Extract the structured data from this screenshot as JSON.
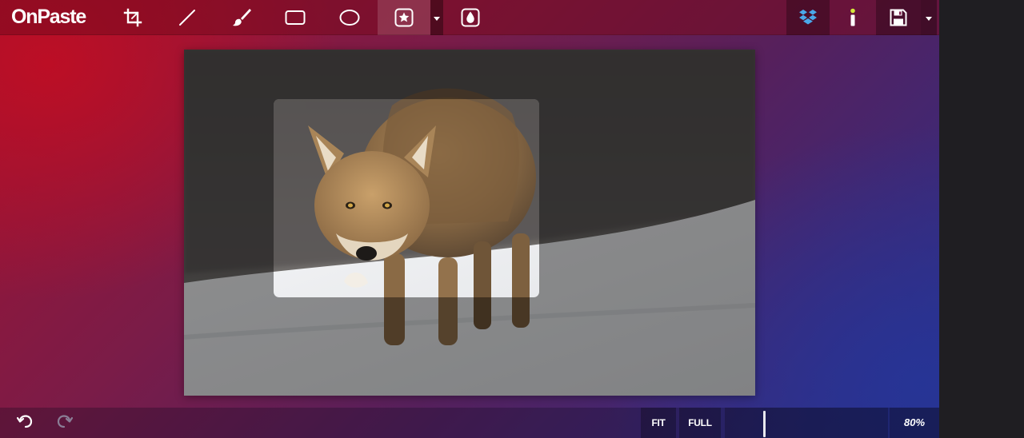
{
  "app": {
    "logo_text": "OnPaste"
  },
  "toolbar": {
    "tools": [
      {
        "id": "crop",
        "icon": "crop-icon"
      },
      {
        "id": "line",
        "icon": "line-icon"
      },
      {
        "id": "brush",
        "icon": "brush-icon"
      },
      {
        "id": "rectangle",
        "icon": "rectangle-icon"
      },
      {
        "id": "ellipse",
        "icon": "ellipse-icon"
      },
      {
        "id": "star-shape",
        "icon": "star-icon",
        "active": true
      },
      {
        "id": "blur",
        "icon": "drop-icon"
      }
    ],
    "right_tools": [
      {
        "id": "dropbox",
        "icon": "dropbox-icon"
      },
      {
        "id": "info",
        "icon": "info-icon"
      },
      {
        "id": "save",
        "icon": "save-icon"
      }
    ]
  },
  "bottombar": {
    "undo_icon": "undo-icon",
    "redo_icon": "redo-icon",
    "fit_label": "FIT",
    "full_label": "FULL",
    "zoom_label": "80%",
    "zoom_level": 0.24
  },
  "colors": {
    "background_left": "#b8102c",
    "background_right": "#2a338e",
    "dropbox_blue": "#4aa8ea"
  }
}
